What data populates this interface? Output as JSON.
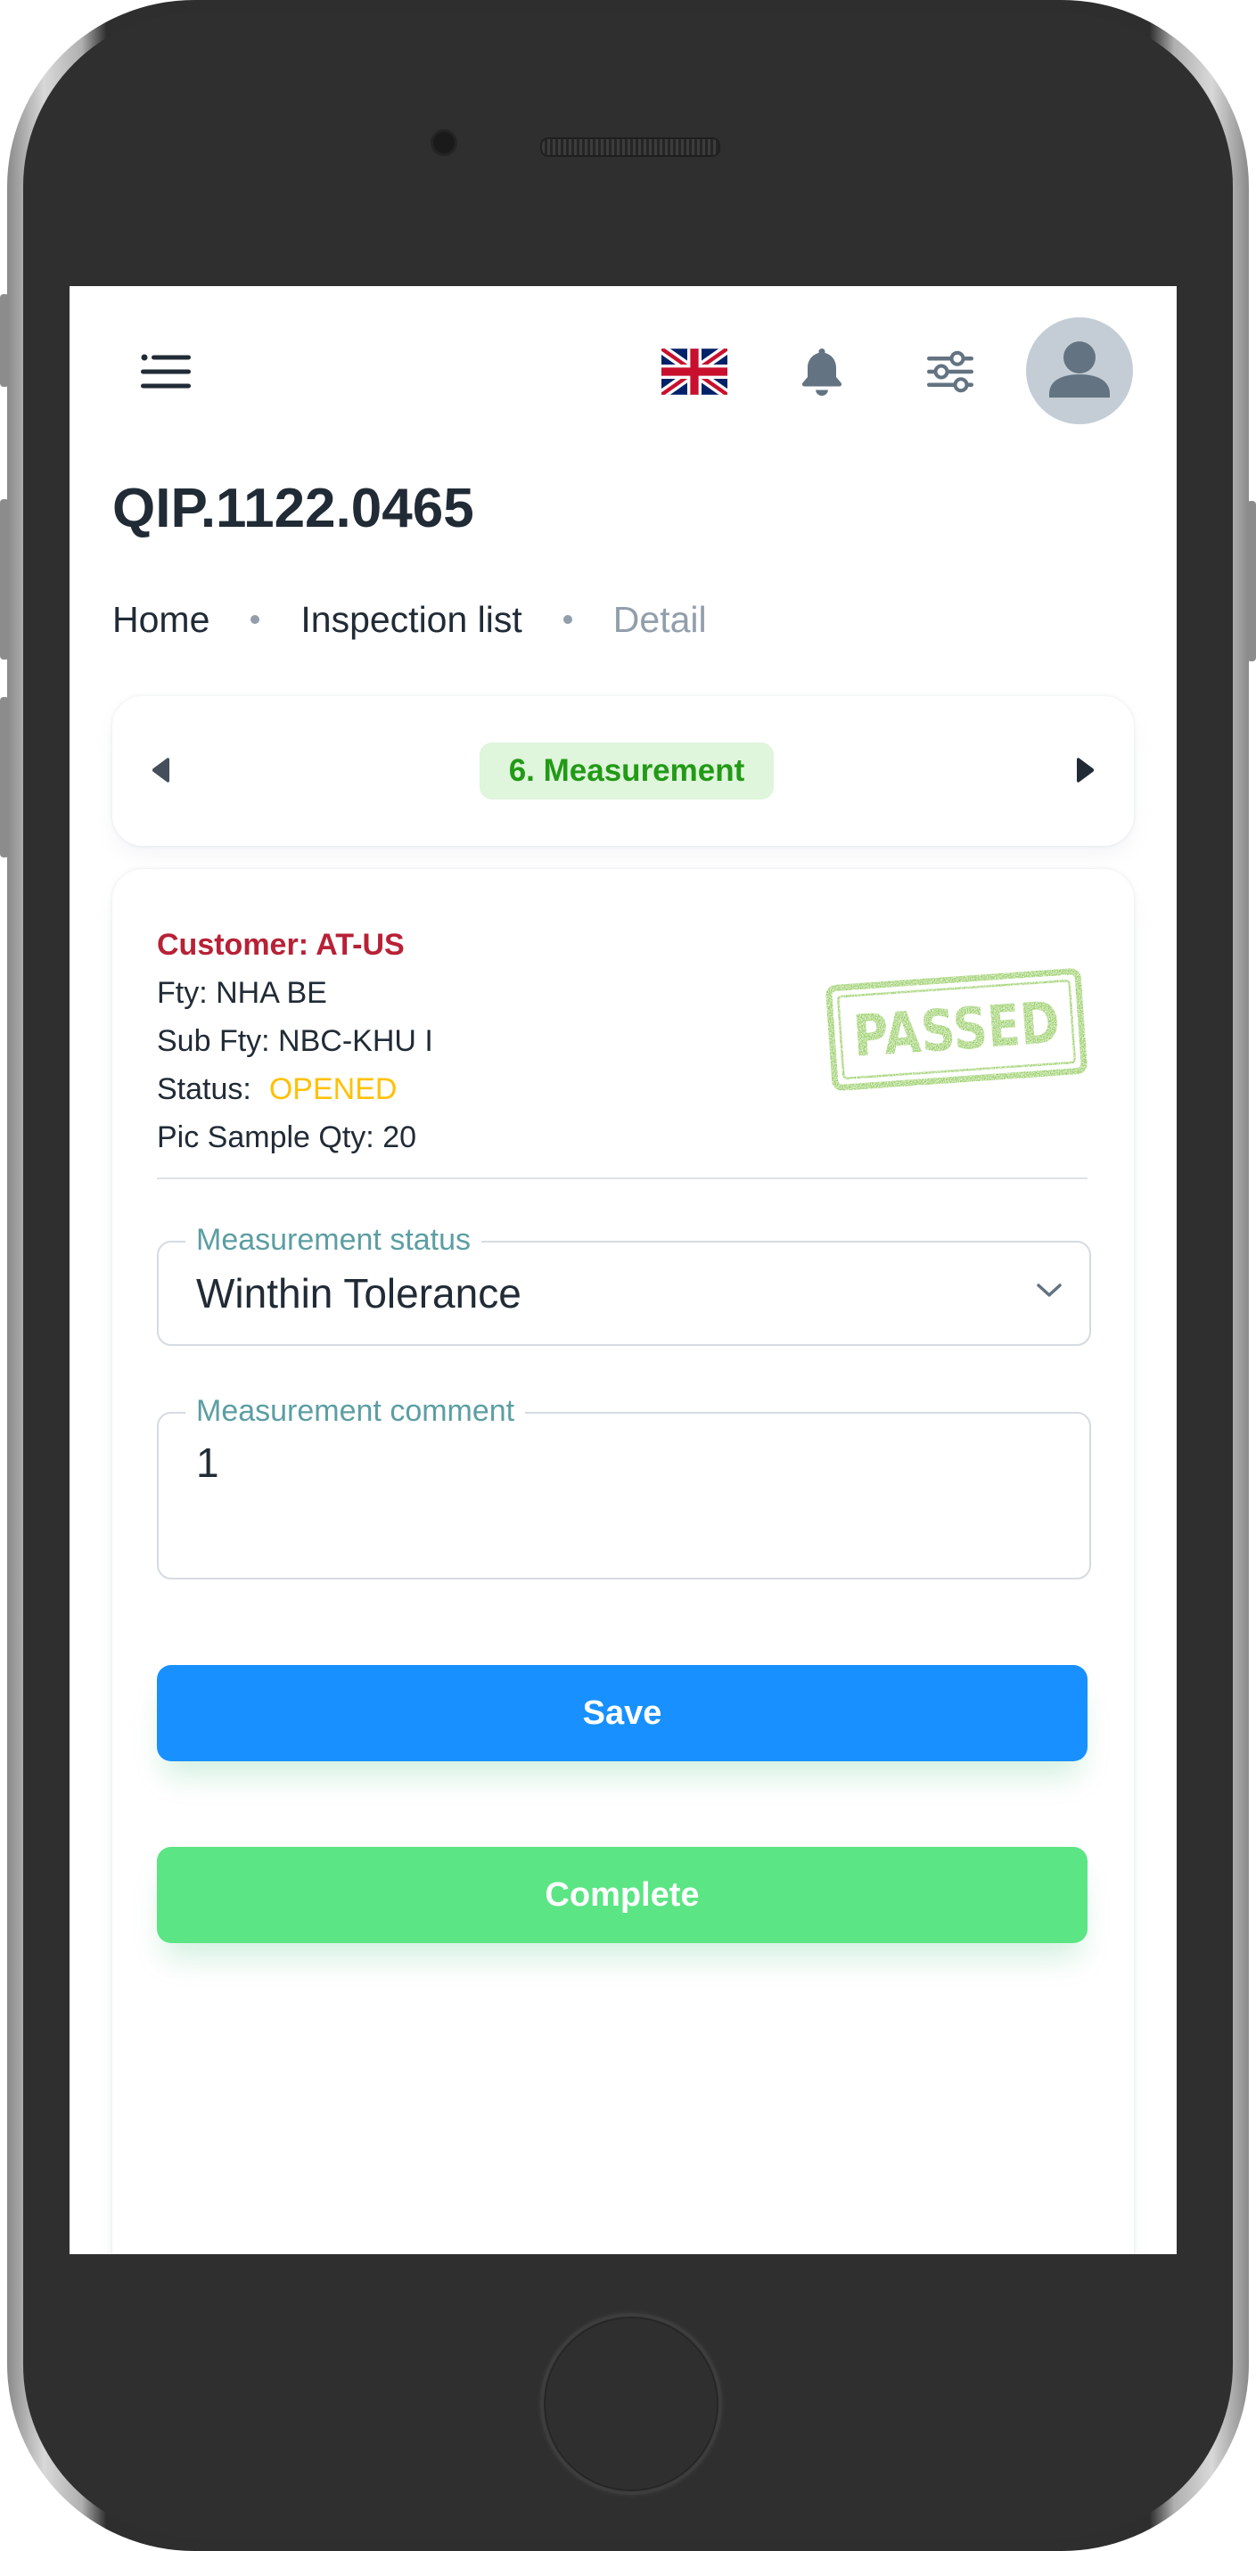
{
  "header": {
    "menu_icon": "menu-icon",
    "language_flag": "uk-flag-icon",
    "notification_icon": "bell-icon",
    "settings_icon": "sliders-icon",
    "avatar_icon": "user-avatar-icon"
  },
  "page": {
    "title": "QIP.1122.0465"
  },
  "breadcrumb": {
    "items": [
      "Home",
      "Inspection list",
      "Detail"
    ]
  },
  "stepper": {
    "current_step": "6. Measurement",
    "prev_icon": "caret-left-icon",
    "next_icon": "caret-right-icon"
  },
  "info": {
    "customer": "Customer: AT-US",
    "fty": "Fty: NHA BE",
    "sub_fty": "Sub Fty: NBC-KHU I",
    "status_label": "Status:",
    "status_value": "OPENED",
    "pic_sample_qty": "Pic Sample Qty: 20",
    "stamp": "PASSED"
  },
  "form": {
    "measurement_status_label": "Measurement status",
    "measurement_status_value": "Winthin Tolerance",
    "measurement_comment_label": "Measurement comment",
    "measurement_comment_value": "1"
  },
  "actions": {
    "save_label": "Save",
    "complete_label": "Complete"
  },
  "colors": {
    "primary": "#1890ff",
    "success": "#5be584",
    "step_text": "#229a16",
    "customer_text": "#b72136",
    "status_opened": "#ffc107",
    "stamp_green": "#7bbf3a"
  }
}
